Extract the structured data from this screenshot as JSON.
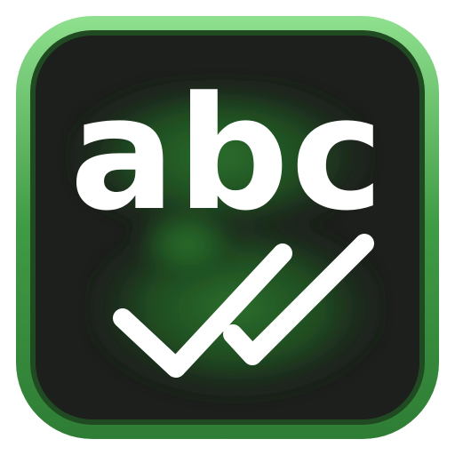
{
  "app_icon": {
    "text": "abc",
    "symbol": "double-checkmark-icon",
    "colors": {
      "frame_outer": "#3f9a45",
      "frame_inner_highlight": "#8fe08f",
      "frame_rim": "#1f4a22",
      "background_dark": "#1c1f1c",
      "glow_green": "#1f5a22",
      "glow_light": "#2c7a2e",
      "foreground": "#ffffff"
    }
  }
}
